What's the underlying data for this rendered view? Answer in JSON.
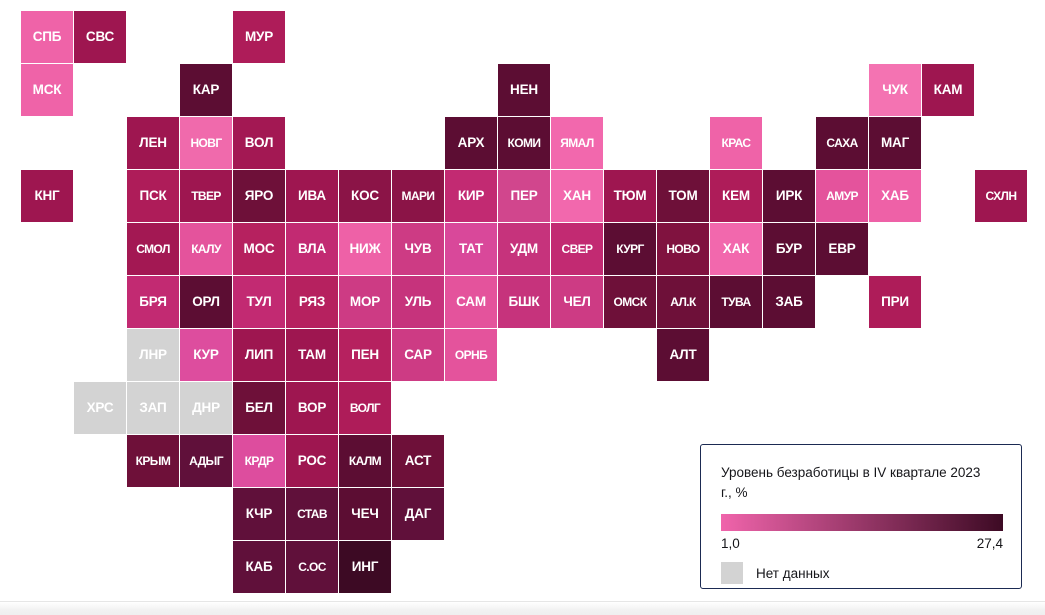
{
  "legend": {
    "title": "Уровень безработицы в IV квартале 2023 г., %",
    "min_label": "1,0",
    "max_label": "27,4",
    "nodata_label": "Нет данных",
    "nodata_color": "#d3d3d3",
    "ramp_start_color": "#f064ab",
    "ramp_end_color": "#3d0a24",
    "border_color": "#1b2a52"
  },
  "chart_data": {
    "type": "heatmap",
    "title": "Уровень безработицы в IV квартале 2023 г., %",
    "xlabel": "",
    "ylabel": "",
    "value_unit": "%",
    "value_range": [
      1.0,
      27.4
    ],
    "colorscale": [
      "#f064ab",
      "#3d0a24"
    ],
    "nodata_color": "#d3d3d3",
    "grid": "tile-cartogram",
    "legend_position": "bottom-right",
    "tile_size": 52,
    "tile_pitch": 53,
    "origin": [
      21,
      11
    ],
    "tiles": [
      {
        "label": "СПБ",
        "col": 0,
        "row": 0,
        "color": "#ef63a8",
        "value": 1.9
      },
      {
        "label": "СВС",
        "col": 1,
        "row": 0,
        "color": "#9e1650",
        "value": 10.3
      },
      {
        "label": "МУР",
        "col": 4,
        "row": 0,
        "color": "#ae1c59",
        "value": 8.5
      },
      {
        "label": "МСК",
        "col": 0,
        "row": 1,
        "color": "#ef63a8",
        "value": 1.9
      },
      {
        "label": "КАР",
        "col": 3,
        "row": 1,
        "color": "#5c0d33",
        "value": 20.1
      },
      {
        "label": "НЕН",
        "col": 9,
        "row": 1,
        "color": "#5c0d33",
        "value": 20.4
      },
      {
        "label": "ЧУК",
        "col": 16,
        "row": 1,
        "color": "#f473b2",
        "value": 2.3
      },
      {
        "label": "КАМ",
        "col": 17,
        "row": 1,
        "color": "#9e1650",
        "value": 10.0
      },
      {
        "label": "ЛЕН",
        "col": 2,
        "row": 2,
        "color": "#9e1650",
        "value": 10.4
      },
      {
        "label": "НОВГ",
        "col": 3,
        "row": 2,
        "color": "#f06aac",
        "value": 2.6
      },
      {
        "label": "ВОЛ",
        "col": 4,
        "row": 2,
        "color": "#a31853",
        "value": 9.6
      },
      {
        "label": "АРХ",
        "col": 8,
        "row": 2,
        "color": "#5c0d33",
        "value": 19.6
      },
      {
        "label": "КОМИ",
        "col": 9,
        "row": 2,
        "color": "#5c0d33",
        "value": 20.8
      },
      {
        "label": "ЯМАЛ",
        "col": 10,
        "row": 2,
        "color": "#f268ad",
        "value": 2.4
      },
      {
        "label": "КРАС",
        "col": 13,
        "row": 2,
        "color": "#ef63a8",
        "value": 2.1
      },
      {
        "label": "САХА",
        "col": 15,
        "row": 2,
        "color": "#5c0d33",
        "value": 20.0
      },
      {
        "label": "МАГ",
        "col": 16,
        "row": 2,
        "color": "#5c0d33",
        "value": 19.5
      },
      {
        "label": "КНГ",
        "col": 0,
        "row": 3,
        "color": "#9e1650",
        "value": 10.5
      },
      {
        "label": "ПСК",
        "col": 2,
        "row": 3,
        "color": "#ae1c59",
        "value": 8.7
      },
      {
        "label": "ТВЕР",
        "col": 3,
        "row": 3,
        "color": "#9e1650",
        "value": 10.6
      },
      {
        "label": "ЯРО",
        "col": 4,
        "row": 3,
        "color": "#6e1039",
        "value": 16.2
      },
      {
        "label": "ИВА",
        "col": 5,
        "row": 3,
        "color": "#9e1650",
        "value": 10.8
      },
      {
        "label": "КОС",
        "col": 6,
        "row": 3,
        "color": "#8b1447",
        "value": 12.6
      },
      {
        "label": "МАРИ",
        "col": 7,
        "row": 3,
        "color": "#8b1447",
        "value": 12.8
      },
      {
        "label": "КИР",
        "col": 8,
        "row": 3,
        "color": "#c22a72",
        "value": 6.3
      },
      {
        "label": "ПЕР",
        "col": 9,
        "row": 3,
        "color": "#d1468d",
        "value": 4.7
      },
      {
        "label": "ХАН",
        "col": 10,
        "row": 3,
        "color": "#f268ad",
        "value": 2.4
      },
      {
        "label": "ТЮМ",
        "col": 11,
        "row": 3,
        "color": "#9e1650",
        "value": 10.5
      },
      {
        "label": "ТОМ",
        "col": 12,
        "row": 3,
        "color": "#6e1039",
        "value": 16.1
      },
      {
        "label": "КЕМ",
        "col": 13,
        "row": 3,
        "color": "#ae1c59",
        "value": 8.6
      },
      {
        "label": "ИРК",
        "col": 14,
        "row": 3,
        "color": "#5c0d33",
        "value": 19.3
      },
      {
        "label": "АМУР",
        "col": 15,
        "row": 3,
        "color": "#e4539c",
        "value": 3.3
      },
      {
        "label": "ХАБ",
        "col": 16,
        "row": 3,
        "color": "#ee61a7",
        "value": 2.5
      },
      {
        "label": "СХЛН",
        "col": 18,
        "row": 3,
        "color": "#9e1650",
        "value": 10.2
      },
      {
        "label": "СМОЛ",
        "col": 2,
        "row": 4,
        "color": "#a31853",
        "value": 9.8
      },
      {
        "label": "КАЛУ",
        "col": 3,
        "row": 4,
        "color": "#e4539c",
        "value": 3.5
      },
      {
        "label": "МОС",
        "col": 4,
        "row": 4,
        "color": "#b6215f",
        "value": 7.9
      },
      {
        "label": "ВЛА",
        "col": 5,
        "row": 4,
        "color": "#c22a72",
        "value": 6.2
      },
      {
        "label": "НИЖ",
        "col": 6,
        "row": 4,
        "color": "#ee61a7",
        "value": 2.6
      },
      {
        "label": "ЧУВ",
        "col": 7,
        "row": 4,
        "color": "#cd3b84",
        "value": 5.5
      },
      {
        "label": "ТАТ",
        "col": 8,
        "row": 4,
        "color": "#d9489a",
        "value": 4.4
      },
      {
        "label": "УДМ",
        "col": 9,
        "row": 4,
        "color": "#c6337c",
        "value": 6.0
      },
      {
        "label": "СВЕР",
        "col": 10,
        "row": 4,
        "color": "#c22a72",
        "value": 6.4
      },
      {
        "label": "КУРГ",
        "col": 11,
        "row": 4,
        "color": "#5c0d33",
        "value": 19.8
      },
      {
        "label": "НОВО",
        "col": 12,
        "row": 4,
        "color": "#80123f",
        "value": 13.8
      },
      {
        "label": "ХАК",
        "col": 13,
        "row": 4,
        "color": "#f268ad",
        "value": 2.4
      },
      {
        "label": "БУР",
        "col": 14,
        "row": 4,
        "color": "#5c0d33",
        "value": 19.7
      },
      {
        "label": "ЕВР",
        "col": 15,
        "row": 4,
        "color": "#5c0d33",
        "value": 20.2
      },
      {
        "label": "БРЯ",
        "col": 2,
        "row": 5,
        "color": "#c22a72",
        "value": 6.5
      },
      {
        "label": "ОРЛ",
        "col": 3,
        "row": 5,
        "color": "#5c0d33",
        "value": 20.3
      },
      {
        "label": "ТУЛ",
        "col": 4,
        "row": 5,
        "color": "#c22a72",
        "value": 6.4
      },
      {
        "label": "РЯЗ",
        "col": 5,
        "row": 5,
        "color": "#b6215f",
        "value": 7.8
      },
      {
        "label": "МОР",
        "col": 6,
        "row": 5,
        "color": "#cd3b84",
        "value": 5.3
      },
      {
        "label": "УЛЬ",
        "col": 7,
        "row": 5,
        "color": "#c6337c",
        "value": 5.9
      },
      {
        "label": "САМ",
        "col": 8,
        "row": 5,
        "color": "#e4539c",
        "value": 3.4
      },
      {
        "label": "БШК",
        "col": 9,
        "row": 5,
        "color": "#c6337c",
        "value": 5.8
      },
      {
        "label": "ЧЕЛ",
        "col": 10,
        "row": 5,
        "color": "#cd3b84",
        "value": 5.2
      },
      {
        "label": "ОМСК",
        "col": 11,
        "row": 5,
        "color": "#6e1039",
        "value": 16.4
      },
      {
        "label": "АЛ.К",
        "col": 12,
        "row": 5,
        "color": "#6e1039",
        "value": 15.9
      },
      {
        "label": "ТУВА",
        "col": 13,
        "row": 5,
        "color": "#5c0d33",
        "value": 19.9
      },
      {
        "label": "ЗАБ",
        "col": 14,
        "row": 5,
        "color": "#5c0d33",
        "value": 19.4
      },
      {
        "label": "ПРИ",
        "col": 16,
        "row": 5,
        "color": "#ae1c59",
        "value": 8.8
      },
      {
        "label": "ЛНР",
        "col": 2,
        "row": 6,
        "color": "#d3d3d3",
        "value": null
      },
      {
        "label": "КУР",
        "col": 3,
        "row": 6,
        "color": "#dd4d9e",
        "value": 3.9
      },
      {
        "label": "ЛИП",
        "col": 4,
        "row": 6,
        "color": "#9e1650",
        "value": 10.9
      },
      {
        "label": "ТАМ",
        "col": 5,
        "row": 6,
        "color": "#9e1650",
        "value": 10.7
      },
      {
        "label": "ПЕН",
        "col": 6,
        "row": 6,
        "color": "#b6215f",
        "value": 7.7
      },
      {
        "label": "САР",
        "col": 7,
        "row": 6,
        "color": "#cd3b84",
        "value": 5.4
      },
      {
        "label": "ОРНБ",
        "col": 8,
        "row": 6,
        "color": "#e4539c",
        "value": 3.6
      },
      {
        "label": "АЛТ",
        "col": 12,
        "row": 6,
        "color": "#5c0d33",
        "value": 20.6
      },
      {
        "label": "ХРС",
        "col": 1,
        "row": 7,
        "color": "#d3d3d3",
        "value": null
      },
      {
        "label": "ЗАП",
        "col": 2,
        "row": 7,
        "color": "#d3d3d3",
        "value": null
      },
      {
        "label": "ДНР",
        "col": 3,
        "row": 7,
        "color": "#d3d3d3",
        "value": null
      },
      {
        "label": "БЕЛ",
        "col": 4,
        "row": 7,
        "color": "#6e1039",
        "value": 16.0
      },
      {
        "label": "ВОР",
        "col": 5,
        "row": 7,
        "color": "#9e1650",
        "value": 10.1
      },
      {
        "label": "ВОЛГ",
        "col": 6,
        "row": 7,
        "color": "#ae1c59",
        "value": 8.4
      },
      {
        "label": "КРЫМ",
        "col": 2,
        "row": 8,
        "color": "#6e1039",
        "value": 16.3
      },
      {
        "label": "АДЫГ",
        "col": 3,
        "row": 8,
        "color": "#60103a",
        "value": 18.4
      },
      {
        "label": "КРДР",
        "col": 4,
        "row": 8,
        "color": "#dd4d9e",
        "value": 3.8
      },
      {
        "label": "РОС",
        "col": 5,
        "row": 8,
        "color": "#9e1650",
        "value": 10.2
      },
      {
        "label": "КАЛМ",
        "col": 6,
        "row": 8,
        "color": "#5c0d33",
        "value": 20.5
      },
      {
        "label": "АСТ",
        "col": 7,
        "row": 8,
        "color": "#6e1039",
        "value": 16.5
      },
      {
        "label": "КЧР",
        "col": 4,
        "row": 9,
        "color": "#60103a",
        "value": 18.2
      },
      {
        "label": "СТАВ",
        "col": 5,
        "row": 9,
        "color": "#60103a",
        "value": 18.0
      },
      {
        "label": "ЧЕЧ",
        "col": 6,
        "row": 9,
        "color": "#5c0d33",
        "value": 20.7
      },
      {
        "label": "ДАГ",
        "col": 7,
        "row": 9,
        "color": "#60103a",
        "value": 18.6
      },
      {
        "label": "КАБ",
        "col": 4,
        "row": 10,
        "color": "#60103a",
        "value": 18.1
      },
      {
        "label": "С.ОС",
        "col": 5,
        "row": 10,
        "color": "#60103a",
        "value": 18.3
      },
      {
        "label": "ИНГ",
        "col": 6,
        "row": 10,
        "color": "#3d0a24",
        "value": 27.4
      }
    ]
  }
}
